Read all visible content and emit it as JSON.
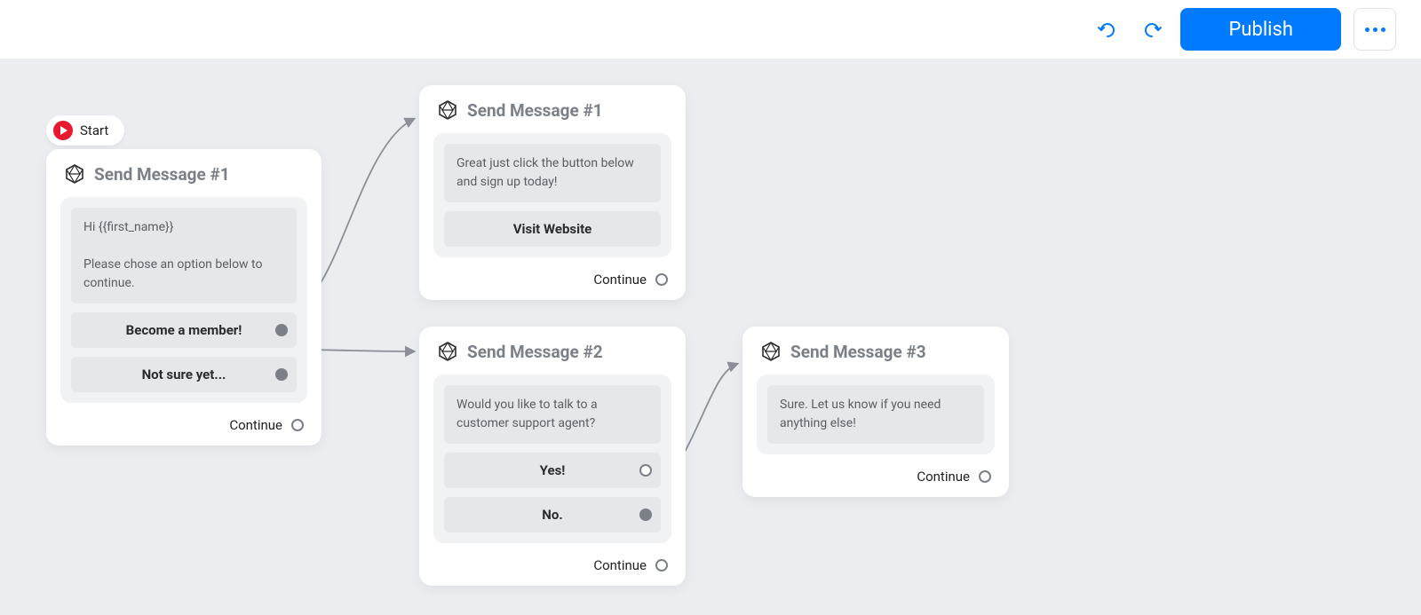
{
  "toolbar": {
    "publish_label": "Publish"
  },
  "start": {
    "label": "Start"
  },
  "nodes": {
    "a": {
      "title": "Send Message #1",
      "message": "Hi {{first_name}}\n\nPlease chose an option below to continue.",
      "options": [
        {
          "label": "Become a member!",
          "connected": true
        },
        {
          "label": "Not sure yet...",
          "connected": true
        }
      ],
      "continue": "Continue"
    },
    "b": {
      "title": "Send Message #1",
      "message": "Great just click the button below and sign up today!",
      "button": "Visit Website",
      "continue": "Continue"
    },
    "c": {
      "title": "Send Message #2",
      "message": "Would you like to talk to a customer support agent?",
      "options": [
        {
          "label": "Yes!",
          "connected": false
        },
        {
          "label": "No.",
          "connected": true
        }
      ],
      "continue": "Continue"
    },
    "d": {
      "title": "Send Message #3",
      "message": "Sure. Let us know if you need anything else!",
      "continue": "Continue"
    }
  }
}
